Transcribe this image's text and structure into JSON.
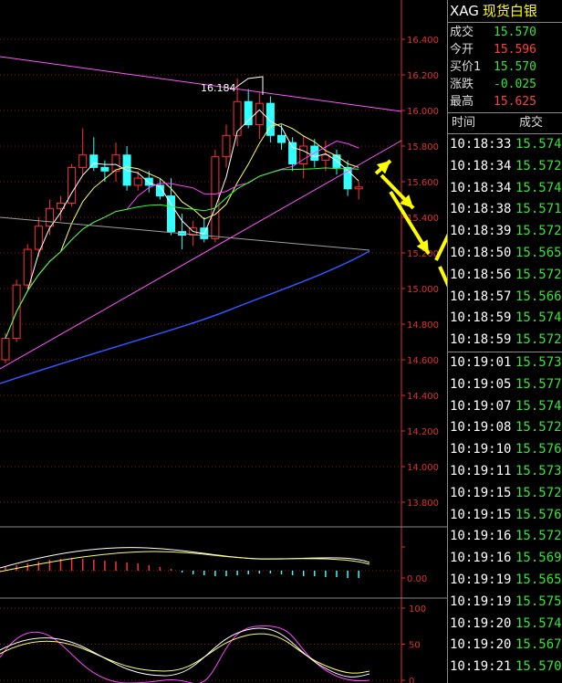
{
  "header": {
    "code": "XAG",
    "name": "现货白银"
  },
  "stats": [
    {
      "label": "成交",
      "value": "15.570",
      "color": "#33e633"
    },
    {
      "label": "今开",
      "value": "15.596",
      "color": "#ff4040"
    },
    {
      "label": "买价1",
      "value": "15.570",
      "color": "#33e633"
    },
    {
      "label": "涨跌",
      "value": "-0.025",
      "color": "#33e633"
    },
    {
      "label": "最高",
      "value": "15.625",
      "color": "#ff4040"
    }
  ],
  "ticks_header": {
    "time": "时间",
    "price": "成交"
  },
  "ticks": [
    {
      "time": "10:18:33",
      "price": "15.574"
    },
    {
      "time": "10:18:34",
      "price": "15.572"
    },
    {
      "time": "10:18:34",
      "price": "15.574"
    },
    {
      "time": "10:18:38",
      "price": "15.571"
    },
    {
      "time": "10:18:39",
      "price": "15.572"
    },
    {
      "time": "10:18:50",
      "price": "15.565"
    },
    {
      "time": "10:18:56",
      "price": "15.572"
    },
    {
      "time": "10:18:57",
      "price": "15.566"
    },
    {
      "time": "10:18:59",
      "price": "15.574"
    },
    {
      "time": "10:18:59",
      "price": "15.572"
    },
    {
      "time": "10:19:01",
      "price": "15.573"
    },
    {
      "time": "10:19:05",
      "price": "15.577"
    },
    {
      "time": "10:19:07",
      "price": "15.574"
    },
    {
      "time": "10:19:08",
      "price": "15.572"
    },
    {
      "time": "10:19:10",
      "price": "15.576"
    },
    {
      "time": "10:19:11",
      "price": "15.573"
    },
    {
      "time": "10:19:15",
      "price": "15.572"
    },
    {
      "time": "10:19:15",
      "price": "15.576"
    },
    {
      "time": "10:19:16",
      "price": "15.572"
    },
    {
      "time": "10:19:16",
      "price": "15.569"
    },
    {
      "time": "10:19:19",
      "price": "15.565"
    },
    {
      "time": "10:19:19",
      "price": "15.575"
    },
    {
      "time": "10:19:20",
      "price": "15.574"
    },
    {
      "time": "10:19:20",
      "price": "15.567"
    },
    {
      "time": "10:19:21",
      "price": "15.570"
    }
  ],
  "colors": {
    "up": "#ff3333",
    "down": "#33e633",
    "axis": "#e03030",
    "grid": "#8a1a1a"
  },
  "price_axis": {
    "labels": [
      "16.400",
      "16.200",
      "16.000",
      "15.800",
      "15.600",
      "15.400",
      "15.200",
      "15.000",
      "14.800",
      "14.600",
      "14.400",
      "14.200",
      "14.000",
      "13.800"
    ],
    "min": 13.8,
    "max": 16.4
  },
  "macd_axis": {
    "zero_label": "0.00"
  },
  "kdj_axis": {
    "labels": [
      "100",
      "50",
      "0"
    ]
  },
  "high_label": "16.184",
  "candles": [
    {
      "o": 14.6,
      "h": 14.75,
      "l": 14.58,
      "c": 14.72
    },
    {
      "o": 14.72,
      "h": 15.05,
      "l": 14.7,
      "c": 15.02
    },
    {
      "o": 15.02,
      "h": 15.25,
      "l": 15.0,
      "c": 15.22
    },
    {
      "o": 15.22,
      "h": 15.4,
      "l": 15.18,
      "c": 15.35
    },
    {
      "o": 15.35,
      "h": 15.5,
      "l": 15.3,
      "c": 15.45
    },
    {
      "o": 15.45,
      "h": 15.52,
      "l": 15.38,
      "c": 15.48
    },
    {
      "o": 15.48,
      "h": 15.7,
      "l": 15.46,
      "c": 15.68
    },
    {
      "o": 15.68,
      "h": 15.9,
      "l": 15.64,
      "c": 15.75
    },
    {
      "o": 15.75,
      "h": 15.85,
      "l": 15.66,
      "c": 15.68
    },
    {
      "o": 15.68,
      "h": 15.72,
      "l": 15.6,
      "c": 15.66
    },
    {
      "o": 15.66,
      "h": 15.82,
      "l": 15.6,
      "c": 15.75
    },
    {
      "o": 15.75,
      "h": 15.8,
      "l": 15.55,
      "c": 15.58
    },
    {
      "o": 15.58,
      "h": 15.66,
      "l": 15.55,
      "c": 15.62
    },
    {
      "o": 15.62,
      "h": 15.66,
      "l": 15.54,
      "c": 15.58
    },
    {
      "o": 15.58,
      "h": 15.62,
      "l": 15.5,
      "c": 15.52
    },
    {
      "o": 15.52,
      "h": 15.62,
      "l": 15.3,
      "c": 15.32
    },
    {
      "o": 15.32,
      "h": 15.42,
      "l": 15.22,
      "c": 15.3
    },
    {
      "o": 15.3,
      "h": 15.38,
      "l": 15.24,
      "c": 15.34
    },
    {
      "o": 15.34,
      "h": 15.4,
      "l": 15.26,
      "c": 15.28
    },
    {
      "o": 15.28,
      "h": 15.78,
      "l": 15.26,
      "c": 15.74
    },
    {
      "o": 15.74,
      "h": 15.92,
      "l": 15.68,
      "c": 15.86
    },
    {
      "o": 15.86,
      "h": 16.18,
      "l": 15.8,
      "c": 16.05
    },
    {
      "o": 16.05,
      "h": 16.12,
      "l": 15.9,
      "c": 15.92
    },
    {
      "o": 15.92,
      "h": 16.1,
      "l": 15.84,
      "c": 16.04
    },
    {
      "o": 16.04,
      "h": 16.08,
      "l": 15.82,
      "c": 15.86
    },
    {
      "o": 15.86,
      "h": 15.92,
      "l": 15.78,
      "c": 15.82
    },
    {
      "o": 15.82,
      "h": 15.85,
      "l": 15.66,
      "c": 15.7
    },
    {
      "o": 15.7,
      "h": 15.86,
      "l": 15.62,
      "c": 15.8
    },
    {
      "o": 15.8,
      "h": 15.84,
      "l": 15.68,
      "c": 15.72
    },
    {
      "o": 15.72,
      "h": 15.83,
      "l": 15.66,
      "c": 15.75
    },
    {
      "o": 15.75,
      "h": 15.78,
      "l": 15.64,
      "c": 15.68
    },
    {
      "o": 15.68,
      "h": 15.72,
      "l": 15.52,
      "c": 15.56
    },
    {
      "o": 15.56,
      "h": 15.6,
      "l": 15.5,
      "c": 15.57
    }
  ]
}
